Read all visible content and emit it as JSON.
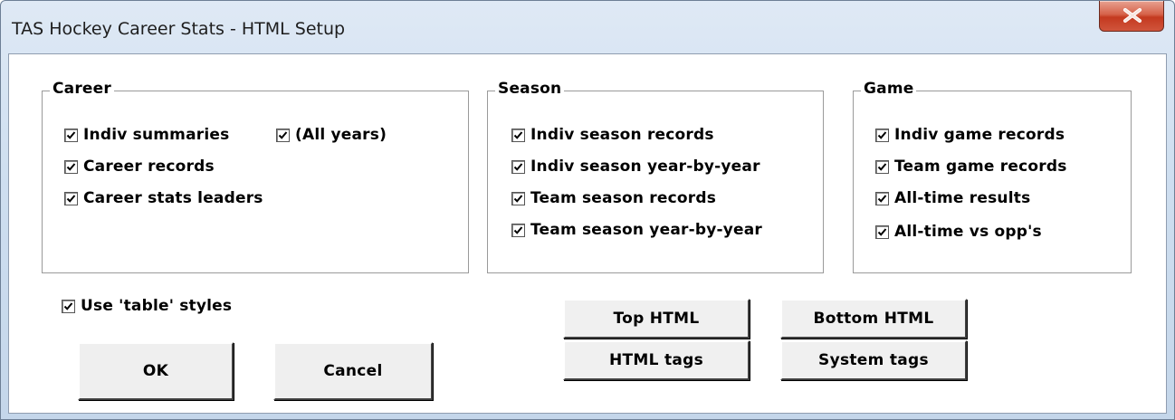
{
  "window": {
    "title": "TAS Hockey Career Stats - HTML Setup",
    "close_glyph": "X"
  },
  "groups": {
    "career": {
      "label": "Career",
      "items": [
        {
          "label": "Indiv summaries",
          "checked": true
        },
        {
          "label": "(All years)",
          "checked": true
        },
        {
          "label": "Career records",
          "checked": true
        },
        {
          "label": "Career stats leaders",
          "checked": true
        }
      ]
    },
    "season": {
      "label": "Season",
      "items": [
        {
          "label": "Indiv season records",
          "checked": true
        },
        {
          "label": "Indiv season year-by-year",
          "checked": true
        },
        {
          "label": "Team season records",
          "checked": true
        },
        {
          "label": "Team season year-by-year",
          "checked": true
        }
      ]
    },
    "game": {
      "label": "Game",
      "items": [
        {
          "label": "Indiv game records",
          "checked": true
        },
        {
          "label": "Team game records",
          "checked": true
        },
        {
          "label": "All-time results",
          "checked": true
        },
        {
          "label": "All-time vs opp's",
          "checked": true
        }
      ]
    }
  },
  "options": {
    "table_styles": {
      "label": "Use 'table' styles",
      "checked": true
    }
  },
  "buttons": {
    "ok": "OK",
    "cancel": "Cancel",
    "top_html": "Top HTML",
    "bottom_html": "Bottom HTML",
    "html_tags": "HTML tags",
    "system_tags": "System tags"
  }
}
